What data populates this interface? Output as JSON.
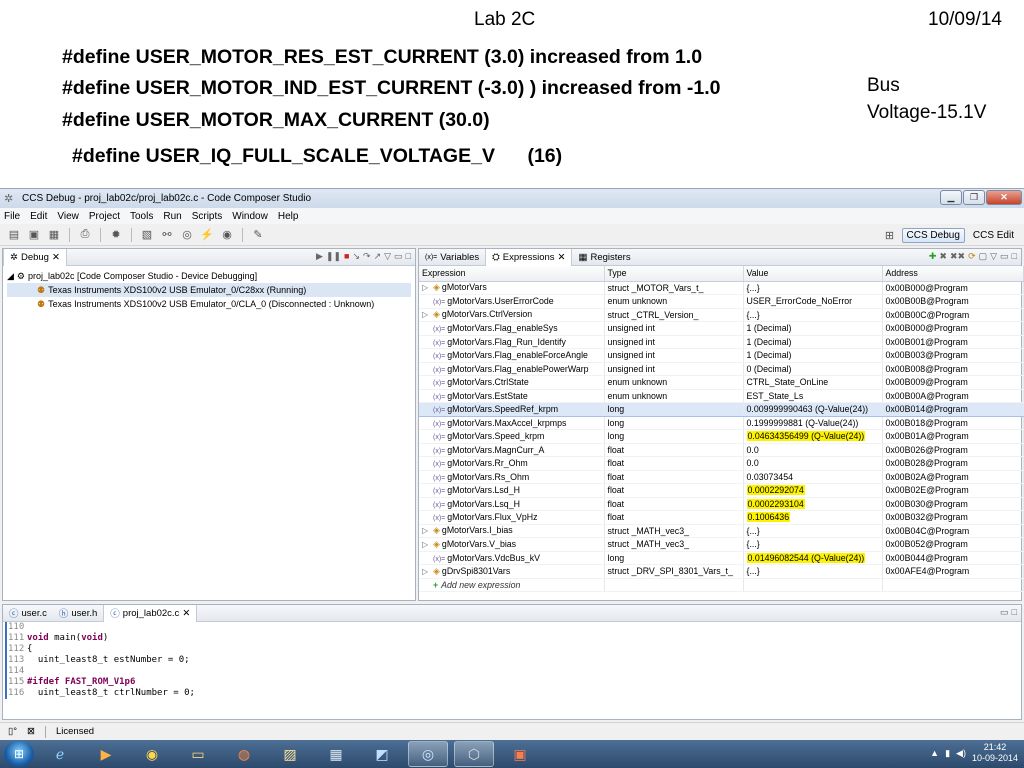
{
  "slide": {
    "title": "Lab 2C",
    "date": "10/09/14",
    "defines": [
      "#define USER_MOTOR_RES_EST_CURRENT (3.0) increased from 1.0",
      "#define USER_MOTOR_IND_EST_CURRENT (-3.0) ) increased from -1.0",
      "#define USER_MOTOR_MAX_CURRENT (30.0)",
      "#define USER_IQ_FULL_SCALE_VOLTAGE_V      (16)"
    ],
    "bus_note_line1": "Bus",
    "bus_note_line2": "Voltage-15.1V"
  },
  "window": {
    "title": "CCS Debug - proj_lab02c/proj_lab02c.c - Code Composer Studio",
    "menu": [
      "File",
      "Edit",
      "View",
      "Project",
      "Tools",
      "Run",
      "Scripts",
      "Window",
      "Help"
    ],
    "perspectives": [
      "CCS Debug",
      "CCS Edit"
    ]
  },
  "debug_panel": {
    "tab": "Debug",
    "tree": [
      "proj_lab02c [Code Composer Studio - Device Debugging]",
      "Texas Instruments XDS100v2 USB Emulator_0/C28xx (Running)",
      "Texas Instruments XDS100v2 USB Emulator_0/CLA_0 (Disconnected : Unknown)"
    ]
  },
  "expressions_panel": {
    "tabs": [
      "Variables",
      "Expressions",
      "Registers"
    ],
    "columns": [
      "Expression",
      "Type",
      "Value",
      "Address"
    ],
    "rows": [
      {
        "expr": "gMotorVars",
        "type": "struct _MOTOR_Vars_t_",
        "value": "{...}",
        "addr": "0x00B000@Program",
        "kind": "struct",
        "hl": false
      },
      {
        "expr": "gMotorVars.UserErrorCode",
        "type": "enum unknown",
        "value": "USER_ErrorCode_NoError",
        "addr": "0x00B00B@Program",
        "kind": "var",
        "hl": false
      },
      {
        "expr": "gMotorVars.CtrlVersion",
        "type": "struct _CTRL_Version_",
        "value": "{...}",
        "addr": "0x00B00C@Program",
        "kind": "struct",
        "hl": false
      },
      {
        "expr": "gMotorVars.Flag_enableSys",
        "type": "unsigned int",
        "value": "1 (Decimal)",
        "addr": "0x00B000@Program",
        "kind": "var",
        "hl": false
      },
      {
        "expr": "gMotorVars.Flag_Run_Identify",
        "type": "unsigned int",
        "value": "1 (Decimal)",
        "addr": "0x00B001@Program",
        "kind": "var",
        "hl": false
      },
      {
        "expr": "gMotorVars.Flag_enableForceAngle",
        "type": "unsigned int",
        "value": "1 (Decimal)",
        "addr": "0x00B003@Program",
        "kind": "var",
        "hl": false
      },
      {
        "expr": "gMotorVars.Flag_enablePowerWarp",
        "type": "unsigned int",
        "value": "0 (Decimal)",
        "addr": "0x00B008@Program",
        "kind": "var",
        "hl": false
      },
      {
        "expr": "gMotorVars.CtrlState",
        "type": "enum unknown",
        "value": "CTRL_State_OnLine",
        "addr": "0x00B009@Program",
        "kind": "var",
        "hl": false
      },
      {
        "expr": "gMotorVars.EstState",
        "type": "enum unknown",
        "value": "EST_State_Ls",
        "addr": "0x00B00A@Program",
        "kind": "var",
        "hl": false
      },
      {
        "expr": "gMotorVars.SpeedRef_krpm",
        "type": "long",
        "value": "0.009999990463 (Q-Value(24))",
        "addr": "0x00B014@Program",
        "kind": "var",
        "hl": false,
        "sel": true
      },
      {
        "expr": "gMotorVars.MaxAccel_krpmps",
        "type": "long",
        "value": "0.1999999881 (Q-Value(24))",
        "addr": "0x00B018@Program",
        "kind": "var",
        "hl": false
      },
      {
        "expr": "gMotorVars.Speed_krpm",
        "type": "long",
        "value": "0.04634356499 (Q-Value(24))",
        "addr": "0x00B01A@Program",
        "kind": "var",
        "hl": true
      },
      {
        "expr": "gMotorVars.MagnCurr_A",
        "type": "float",
        "value": "0.0",
        "addr": "0x00B026@Program",
        "kind": "var",
        "hl": false
      },
      {
        "expr": "gMotorVars.Rr_Ohm",
        "type": "float",
        "value": "0.0",
        "addr": "0x00B028@Program",
        "kind": "var",
        "hl": false
      },
      {
        "expr": "gMotorVars.Rs_Ohm",
        "type": "float",
        "value": "0.03073454",
        "addr": "0x00B02A@Program",
        "kind": "var",
        "hl": false
      },
      {
        "expr": "gMotorVars.Lsd_H",
        "type": "float",
        "value": "0.0002292074",
        "addr": "0x00B02E@Program",
        "kind": "var",
        "hl": true
      },
      {
        "expr": "gMotorVars.Lsq_H",
        "type": "float",
        "value": "0.0002293104",
        "addr": "0x00B030@Program",
        "kind": "var",
        "hl": true
      },
      {
        "expr": "gMotorVars.Flux_VpHz",
        "type": "float",
        "value": "0.1006436",
        "addr": "0x00B032@Program",
        "kind": "var",
        "hl": true
      },
      {
        "expr": "gMotorVars.I_bias",
        "type": "struct _MATH_vec3_",
        "value": "{...}",
        "addr": "0x00B04C@Program",
        "kind": "struct",
        "hl": false
      },
      {
        "expr": "gMotorVars.V_bias",
        "type": "struct _MATH_vec3_",
        "value": "{...}",
        "addr": "0x00B052@Program",
        "kind": "struct",
        "hl": false
      },
      {
        "expr": "gMotorVars.VdcBus_kV",
        "type": "long",
        "value": "0.01496082544 (Q-Value(24))",
        "addr": "0x00B044@Program",
        "kind": "var",
        "hl": true
      },
      {
        "expr": "gDrvSpi8301Vars",
        "type": "struct _DRV_SPI_8301_Vars_t_",
        "value": "{...}",
        "addr": "0x00AFE4@Program",
        "kind": "struct",
        "hl": false
      }
    ],
    "add_label": "Add new expression"
  },
  "editor": {
    "tabs": [
      "user.c",
      "user.h",
      "proj_lab02c.c"
    ],
    "lines": [
      {
        "n": "110",
        "text": ""
      },
      {
        "n": "111",
        "text": "void main(void)"
      },
      {
        "n": "112",
        "text": "{"
      },
      {
        "n": "113",
        "text": "  uint_least8_t estNumber = 0;"
      },
      {
        "n": "114",
        "text": ""
      },
      {
        "n": "115",
        "text": "#ifdef FAST_ROM_V1p6"
      },
      {
        "n": "116",
        "text": "  uint_least8_t ctrlNumber = 0;"
      }
    ]
  },
  "statusbar": {
    "license": "Licensed"
  },
  "taskbar": {
    "time": "21:42",
    "date": "10-09-2014"
  }
}
